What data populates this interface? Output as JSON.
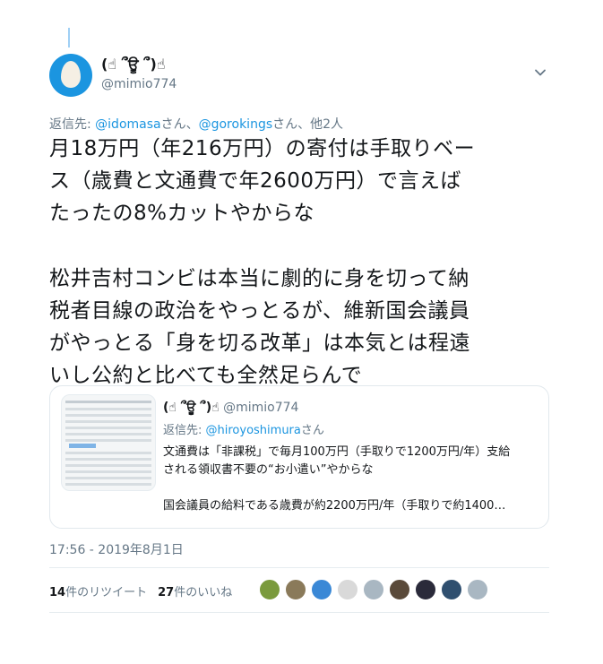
{
  "tweet": {
    "display_name": "(☝ ՞ਊ ՞)☝",
    "handle": "@mimio774",
    "reply_to_prefix": "返信先: ",
    "reply_to_user1": "@idomasa",
    "reply_to_sep1": "さん、",
    "reply_to_user2": "@gorokings",
    "reply_to_suffix": "さん、他2人",
    "text_lines": [
      "月18万円（年216万円）の寄付は手取りベー",
      "ス（歳費と文通費で年2600万円）で言えば",
      "たったの8%カットやからな",
      "松井吉村コンビは本当に劇的に身を切って納",
      "税者目線の政治をやっとるが、維新国会議員",
      "がやっとる「身を切る改革」は本気とは程遠",
      "いし公約と比べても全然足らんで"
    ],
    "timestamp": "17:56 - 2019年8月1日"
  },
  "quote": {
    "display_name": "(☝ ՞ਊ ՞)☝",
    "handle": "@mimio774",
    "reply_prefix": "返信先: ",
    "reply_user": "@hiroyoshimura",
    "reply_suffix": "さん",
    "body_line1": "文通費は「非課税」で毎月100万円（手取りで1200万円/年）支給",
    "body_line2": "される領収書不要の“お小遣い”やからな",
    "body_line3": "国会議員の給料である歳費が約2200万円/年（手取りで約1400…"
  },
  "stats": {
    "retweet_count": "14",
    "retweet_label": "件のリツイート",
    "like_count": "27",
    "like_label": "件のいいね"
  },
  "colors": {
    "link": "#1b95e0",
    "secondary_text": "#657786",
    "avatar_bg": "#1b95e0"
  },
  "likers": [
    {
      "name": "liker-avatar-1",
      "color": "#7a9a3c"
    },
    {
      "name": "liker-avatar-2",
      "color": "#8a7a5a"
    },
    {
      "name": "liker-avatar-3",
      "color": "#3a88d6"
    },
    {
      "name": "liker-avatar-4",
      "color": "#d9d9d9"
    },
    {
      "name": "liker-avatar-5",
      "color": "#a9b7c2"
    },
    {
      "name": "liker-avatar-6",
      "color": "#5a4a3a"
    },
    {
      "name": "liker-avatar-7",
      "color": "#2a2a3a"
    },
    {
      "name": "liker-avatar-8",
      "color": "#2f4f6f"
    },
    {
      "name": "liker-avatar-9",
      "color": "#a9b7c2"
    }
  ]
}
